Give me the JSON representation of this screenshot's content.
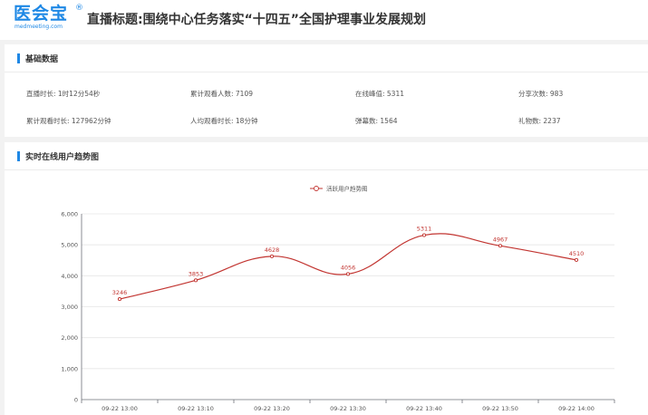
{
  "header": {
    "logo_text": "医会宝",
    "logo_reg": "®",
    "logo_sub": "medmeeting.com",
    "title": "直播标题:围绕中心任务落实“十四五”全国护理事业发展规划"
  },
  "basic": {
    "section_title": "基础数据",
    "stats": [
      {
        "label": "直播时长: 1时12分54秒"
      },
      {
        "label": "累计观看人数: 7109"
      },
      {
        "label": "在线峰值: 5311"
      },
      {
        "label": "分享次数: 983"
      },
      {
        "label": "累计观看时长: 127962分钟"
      },
      {
        "label": "人均观看时长: 18分钟"
      },
      {
        "label": "弹幕数: 1564"
      },
      {
        "label": "礼物数: 2237"
      }
    ]
  },
  "trend": {
    "section_title": "实时在线用户趋势图"
  },
  "colors": {
    "accent": "#1e88e5",
    "series": "#c23531"
  },
  "chart_data": {
    "type": "line",
    "smooth": true,
    "categories": [
      "09-22 13:00",
      "09-22 13:10",
      "09-22 13:20",
      "09-22 13:30",
      "09-22 13:40",
      "09-22 13:50",
      "09-22 14:00"
    ],
    "series": [
      {
        "name": "活跃用户趋势图",
        "values": [
          3246,
          3853,
          4628,
          4056,
          5311,
          4967,
          4510
        ]
      }
    ],
    "yticks": [
      "0",
      "1,000",
      "2,000",
      "3,000",
      "4,000",
      "5,000",
      "6,000"
    ],
    "ylim": [
      0,
      6000
    ],
    "grid": true,
    "legend": "top-center",
    "data_labels": true
  }
}
